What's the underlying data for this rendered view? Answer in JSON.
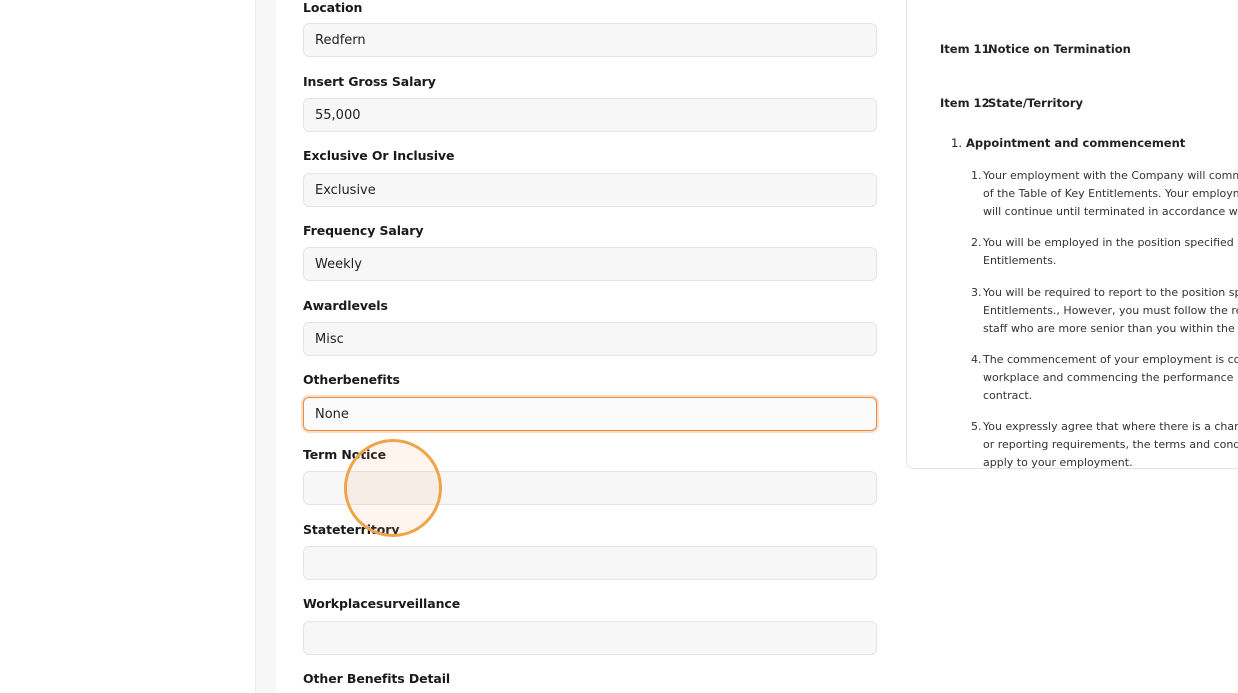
{
  "form": {
    "fields": [
      {
        "label": "Location",
        "value": "Redfern",
        "placeholder": ""
      },
      {
        "label": "Insert Gross Salary",
        "value": "55,000",
        "placeholder": ""
      },
      {
        "label": "Exclusive Or Inclusive",
        "value": "Exclusive",
        "placeholder": ""
      },
      {
        "label": "Frequency Salary",
        "value": "Weekly",
        "placeholder": ""
      },
      {
        "label": "Awardlevels",
        "value": "Misc",
        "placeholder": ""
      },
      {
        "label": "Otherbenefits",
        "value": "None",
        "placeholder": ""
      },
      {
        "label": "Term Notice",
        "value": "",
        "placeholder": ""
      },
      {
        "label": "Stateterritory",
        "value": "",
        "placeholder": ""
      },
      {
        "label": "Workplacesurveillance",
        "value": "",
        "placeholder": ""
      },
      {
        "label": "Other Benefits Detail",
        "value": "",
        "placeholder": ""
      }
    ]
  },
  "preview": {
    "items": [
      {
        "number": "Item 11",
        "title": "Notice on Termination"
      },
      {
        "number": "Item 12",
        "title": "State/Territory"
      }
    ],
    "clause": {
      "number": "1.",
      "title": "Appointment and commencement",
      "subclauses": [
        {
          "number": "1.",
          "lines": [
            "Your employment with the Company will comm",
            "of the Table of Key Entitlements. Your employm",
            "will continue until terminated in accordance wit"
          ]
        },
        {
          "number": "2.",
          "lines": [
            "You will be employed in the position specified i",
            "Entitlements."
          ]
        },
        {
          "number": "3.",
          "lines": [
            "You will be required to report to the position sp",
            "Entitlements., However, you must follow the rea",
            "staff who are more senior than you within the C"
          ]
        },
        {
          "number": "4.",
          "lines": [
            "The commencement of your employment is co",
            "workplace and commencing the performance",
            "contract."
          ]
        },
        {
          "number": "5.",
          "lines": [
            "You expressly agree that where there is a chang",
            "or reporting requirements, the terms and condi",
            "apply to your employment."
          ]
        }
      ]
    }
  },
  "colors": {
    "focus_border": "#f08a3c",
    "click_ring": "#f2a24a",
    "input_bg": "#f7f7f7"
  }
}
